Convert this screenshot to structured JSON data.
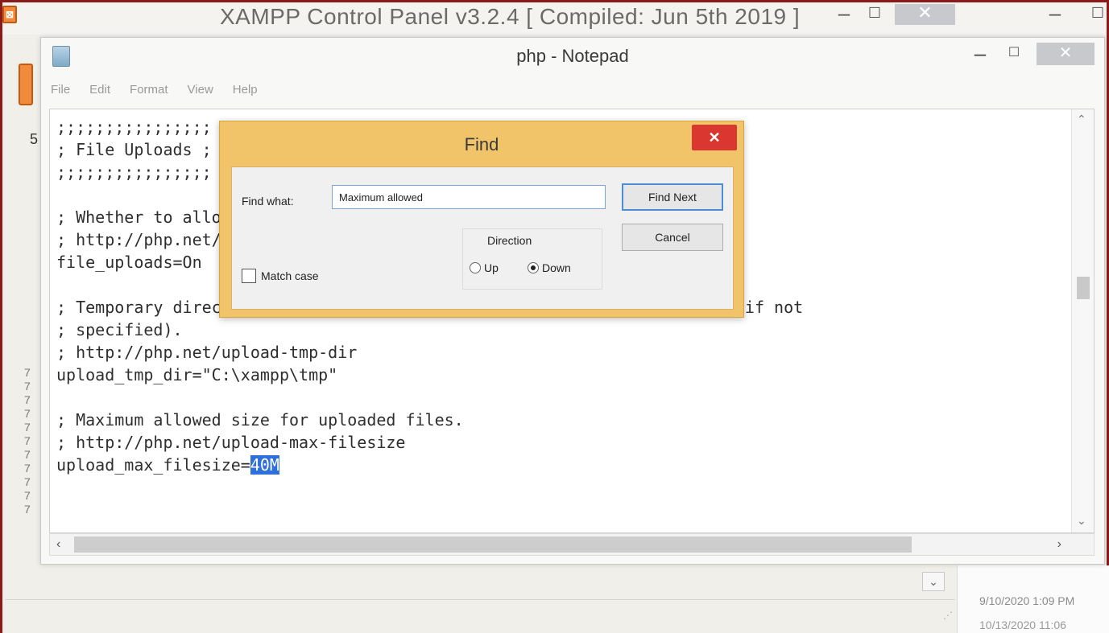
{
  "xampp": {
    "title": "XAMPP Control Panel v3.2.4   [ Compiled: Jun 5th 2019 ]",
    "side_number": "5",
    "log_lines": [
      "7",
      "7",
      "7",
      "7",
      "7",
      "7",
      "7",
      "7",
      "7",
      "7",
      "7"
    ],
    "timestamps": [
      "9/10/2020 1:09 PM",
      "10/13/2020 11:06"
    ],
    "window_controls": {
      "minimize": "–",
      "maximize": "☐",
      "close": "✕"
    }
  },
  "notepad": {
    "title": "php - Notepad",
    "menu": [
      "File",
      "Edit",
      "Format",
      "View",
      "Help"
    ],
    "lines": [
      ";;;;;;;;;;;;;;;;",
      "; File Uploads ;",
      ";;;;;;;;;;;;;;;;",
      "",
      "; Whether to allow HTTP file uploads.",
      "; http://php.net/file-uploads",
      "file_uploads=On",
      "",
      "; Temporary directory for HTTP uploaded files (will use system default if not",
      "; specified).",
      "; http://php.net/upload-tmp-dir",
      "upload_tmp_dir=\"C:\\xampp\\tmp\"",
      "",
      "; Maximum allowed size for uploaded files.",
      "; http://php.net/upload-max-filesize"
    ],
    "last_line_prefix": "upload_max_filesize=",
    "last_line_selected": "40M"
  },
  "find_dialog": {
    "title": "Find",
    "find_what_label": "Find what:",
    "find_what_value": "Maximum allowed",
    "find_next_label": "Find Next",
    "cancel_label": "Cancel",
    "direction_label": "Direction",
    "up_label": "Up",
    "down_label": "Down",
    "direction_selected": "Down",
    "match_case_label": "Match case",
    "match_case_checked": false
  }
}
